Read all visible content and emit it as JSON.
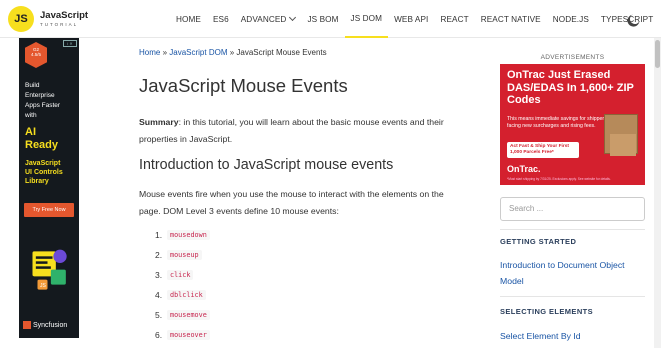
{
  "header": {
    "logo_mark": "JS",
    "logo_title": "JavaScript",
    "logo_sub": "TUTORIAL",
    "nav": [
      "HOME",
      "ES6",
      "ADVANCED",
      "JS BOM",
      "JS DOM",
      "WEB API",
      "REACT",
      "REACT NATIVE",
      "NODE.JS",
      "TYPESCRIPT"
    ],
    "active_nav": "JS DOM"
  },
  "left_ad": {
    "rating": "4.5/5",
    "lines": [
      "Build",
      "Enterprise",
      "Apps Faster",
      "with"
    ],
    "ai": [
      "AI",
      "Ready"
    ],
    "sub": [
      "JavaScript",
      "UI Controls",
      "Library"
    ],
    "button": "Try Free Now",
    "brand": "Syncfusion"
  },
  "breadcrumb": {
    "home": "Home",
    "sep": " » ",
    "section": "JavaScript DOM",
    "current": "JavaScript Mouse Events"
  },
  "article": {
    "title": "JavaScript Mouse Events",
    "summary_label": "Summary",
    "summary_text": ": in this tutorial, you will learn about the basic mouse events and their properties in JavaScript.",
    "h2": "Introduction to JavaScript mouse events",
    "intro": "Mouse events fire when you use the mouse to interact with the elements on the page. DOM Level 3 events define 10 mouse events:",
    "events": [
      "mousedown",
      "mouseup",
      "click",
      "dblclick",
      "mousemove",
      "mouseover"
    ]
  },
  "sidebar": {
    "ads_label": "ADVERTISEMENTS",
    "ad_headline": "OnTrac Just Erased DAS/EDAS In 1,600+ ZIP Codes",
    "ad_body": "This means immediate savings for shippers facing new surcharges and rising fees.",
    "ad_button": "Act Fast & Ship Your First 1,000 Parcels Free*",
    "ad_brand": "OnTrac.",
    "ad_fine": "*Must start shipping by 7/31/25. Exclusions apply. See website for details.",
    "search_placeholder": "Search ...",
    "sections": [
      {
        "title": "GETTING STARTED",
        "links": [
          "Introduction to Document Object Model"
        ]
      },
      {
        "title": "SELECTING ELEMENTS",
        "links": [
          "Select Element By Id"
        ]
      }
    ]
  }
}
